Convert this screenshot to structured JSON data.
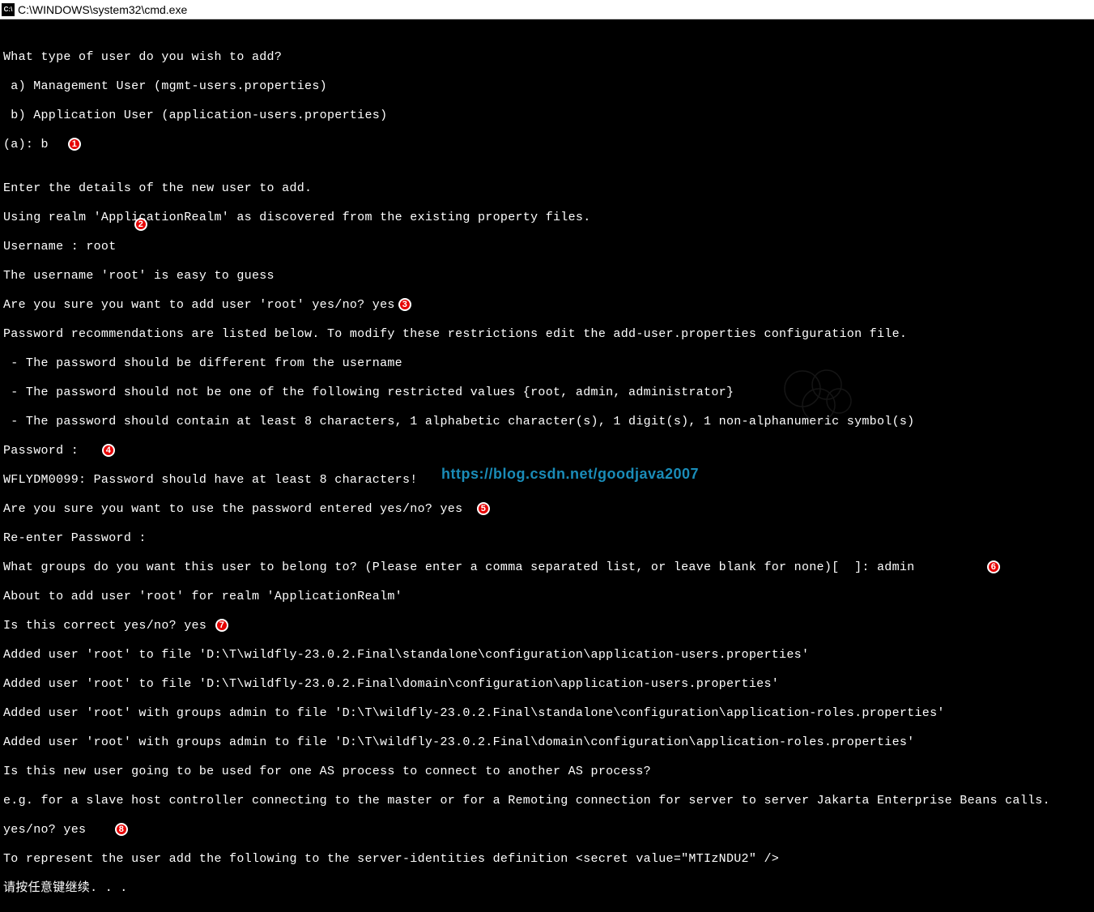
{
  "titlebar": {
    "icon_text": "C:\\",
    "title": "C:\\WINDOWS\\system32\\cmd.exe"
  },
  "lines": {
    "l1": "",
    "l2": "What type of user do you wish to add?",
    "l3": " a) Management User (mgmt-users.properties)",
    "l4": " b) Application User (application-users.properties)",
    "l5": "(a): b",
    "l6": "",
    "l7": "Enter the details of the new user to add.",
    "l8": "Using realm 'ApplicationRealm' as discovered from the existing property files.",
    "l9": "Username : root",
    "l10": "The username 'root' is easy to guess",
    "l11": "Are you sure you want to add user 'root' yes/no? yes",
    "l12": "Password recommendations are listed below. To modify these restrictions edit the add-user.properties configuration file.",
    "l13": " - The password should be different from the username",
    "l14": " - The password should not be one of the following restricted values {root, admin, administrator}",
    "l15": " - The password should contain at least 8 characters, 1 alphabetic character(s), 1 digit(s), 1 non-alphanumeric symbol(s)",
    "l16": "Password :",
    "l17": "WFLYDM0099: Password should have at least 8 characters!",
    "l18": "Are you sure you want to use the password entered yes/no? yes",
    "l19": "Re-enter Password :",
    "l20": "What groups do you want this user to belong to? (Please enter a comma separated list, or leave blank for none)[  ]: admin",
    "l21": "About to add user 'root' for realm 'ApplicationRealm'",
    "l22": "Is this correct yes/no? yes",
    "l23": "Added user 'root' to file 'D:\\T\\wildfly-23.0.2.Final\\standalone\\configuration\\application-users.properties'",
    "l24": "Added user 'root' to file 'D:\\T\\wildfly-23.0.2.Final\\domain\\configuration\\application-users.properties'",
    "l25": "Added user 'root' with groups admin to file 'D:\\T\\wildfly-23.0.2.Final\\standalone\\configuration\\application-roles.properties'",
    "l26": "Added user 'root' with groups admin to file 'D:\\T\\wildfly-23.0.2.Final\\domain\\configuration\\application-roles.properties'",
    "l27": "Is this new user going to be used for one AS process to connect to another AS process?",
    "l28": "e.g. for a slave host controller connecting to the master or for a Remoting connection for server to server Jakarta Enterprise Beans calls.",
    "l29": "yes/no? yes",
    "l30": "To represent the user add the following to the server-identities definition <secret value=\"MTIzNDU2\" />",
    "l31": "请按任意键继续. . ."
  },
  "markers": {
    "m1": "1",
    "m2": "2",
    "m3": "3",
    "m4": "4",
    "m5": "5",
    "m6": "6",
    "m7": "7",
    "m8": "8"
  },
  "watermark": {
    "url": "https://blog.csdn.net/goodjava2007"
  }
}
